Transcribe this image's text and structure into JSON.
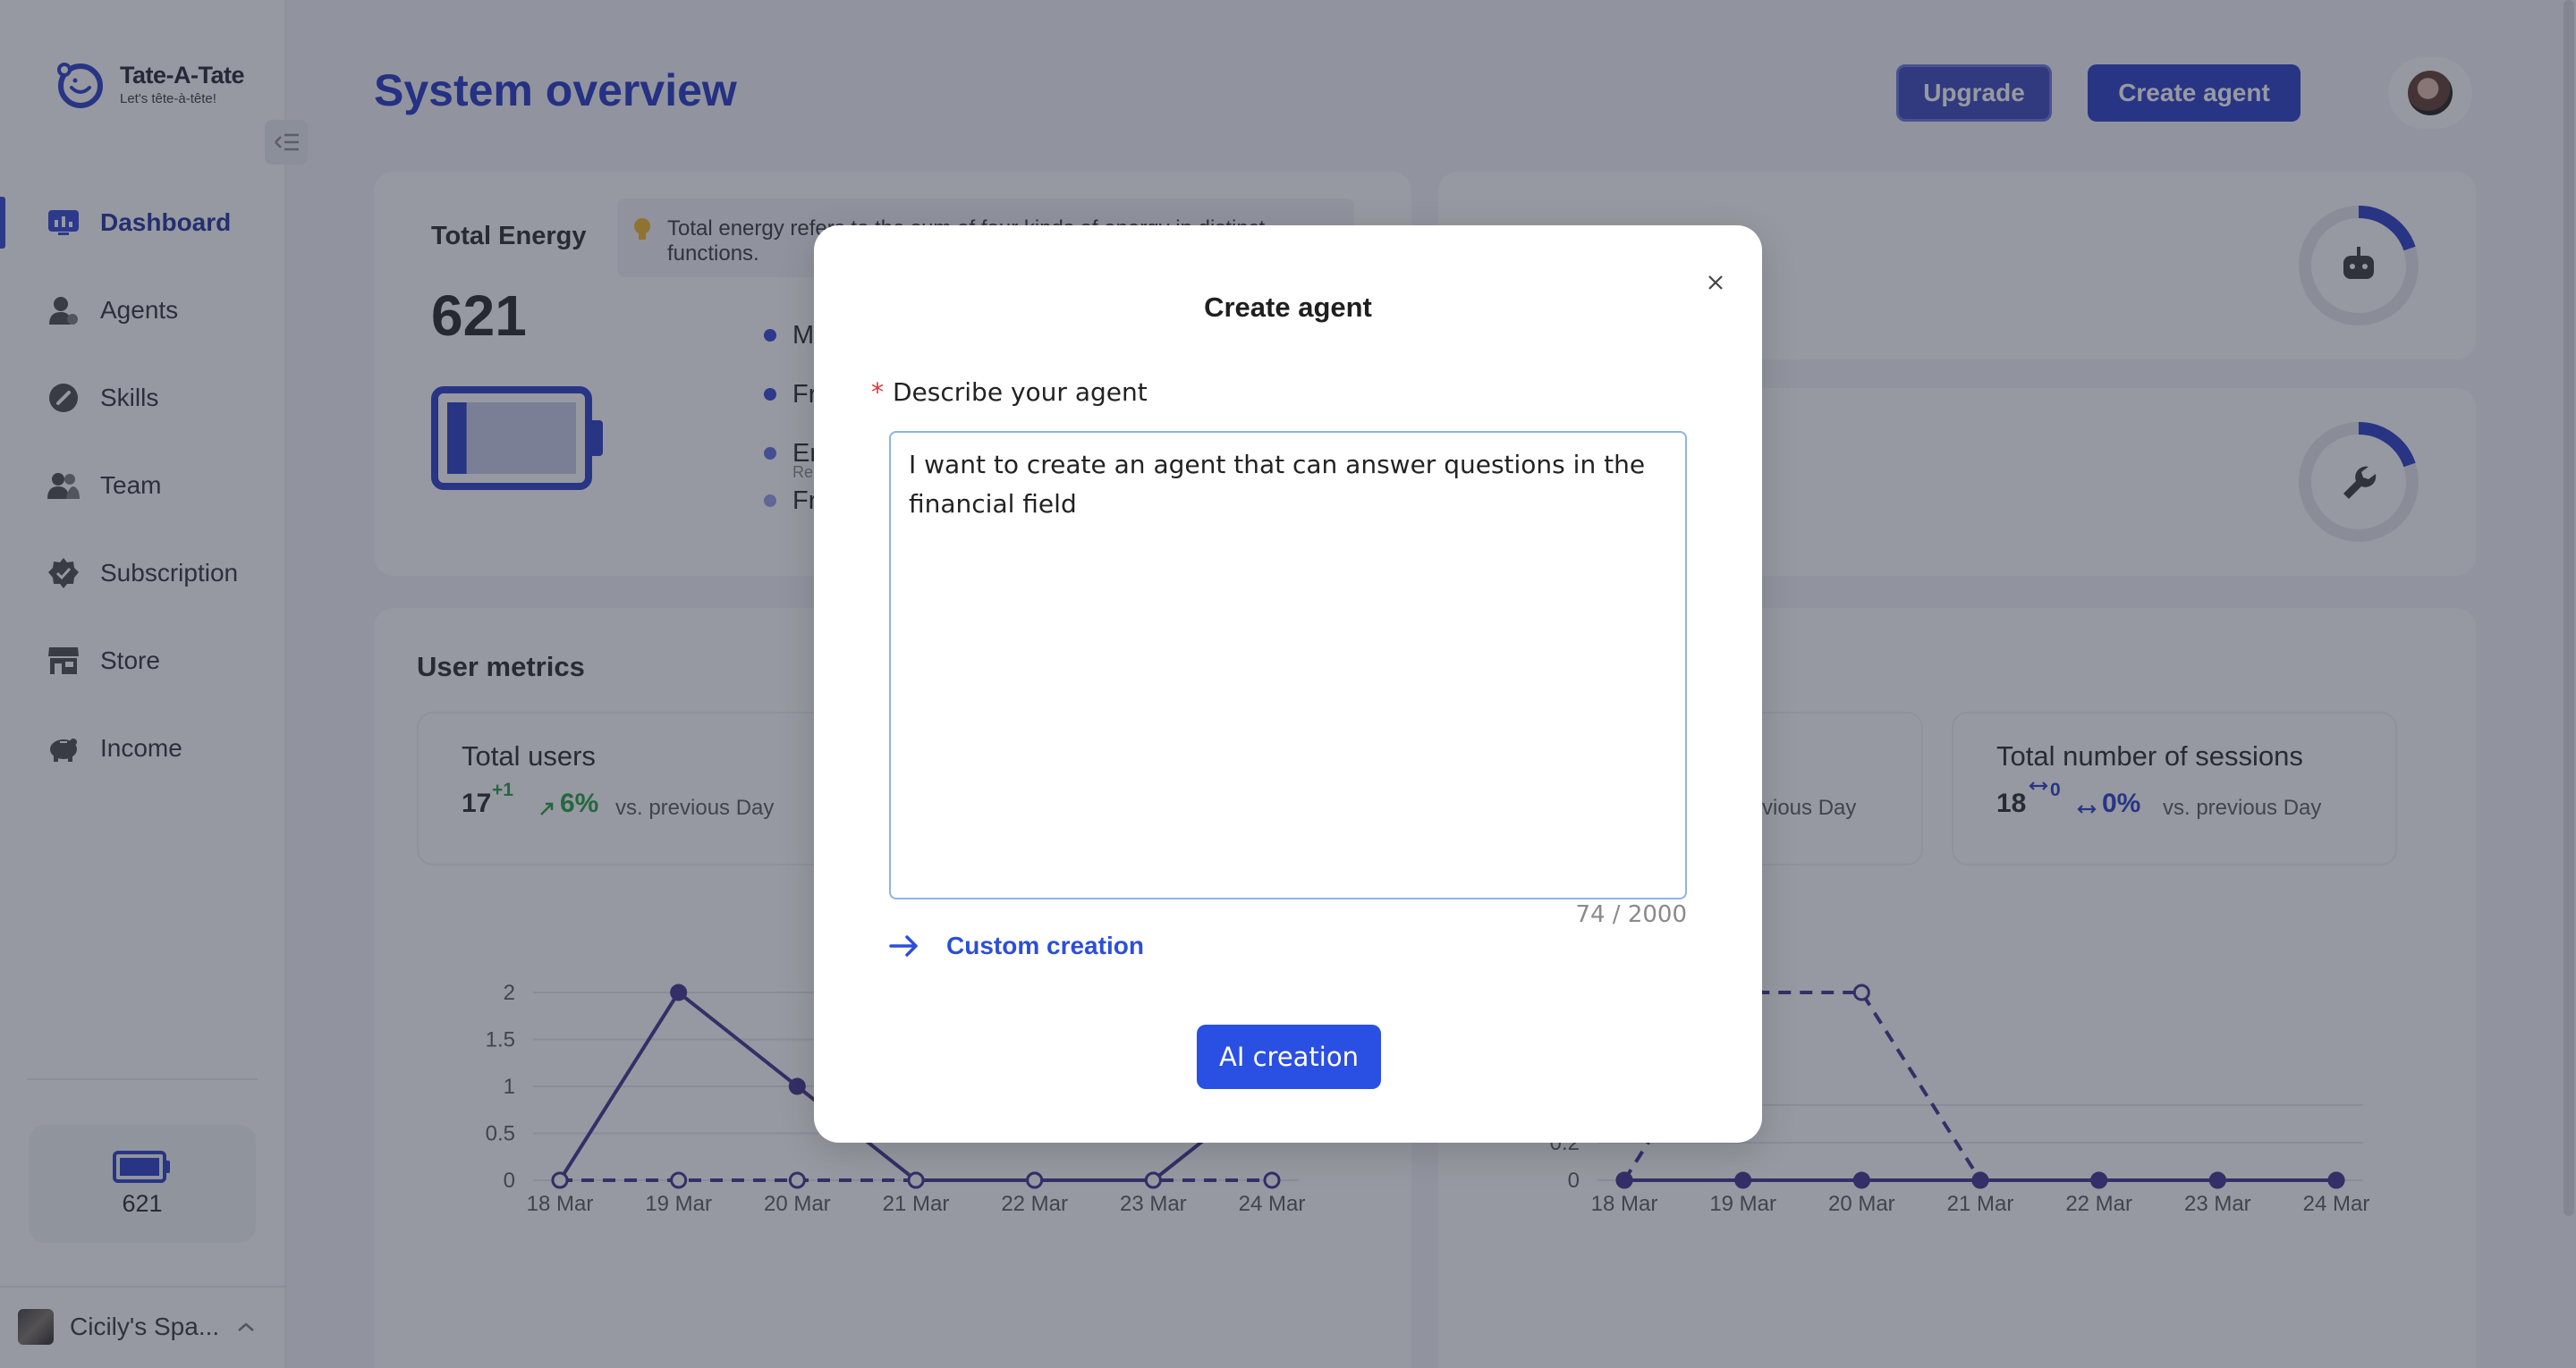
{
  "app": {
    "brand": "Tate-A-Tate",
    "tagline": "Let's tête-à-tête!",
    "page_title": "System overview"
  },
  "header": {
    "upgrade_label": "Upgrade",
    "create_agent_label": "Create agent"
  },
  "sidebar": {
    "items": [
      {
        "label": "Dashboard",
        "icon": "dashboard-icon",
        "active": true
      },
      {
        "label": "Agents",
        "icon": "agent-icon"
      },
      {
        "label": "Skills",
        "icon": "skill-icon"
      },
      {
        "label": "Team",
        "icon": "team-icon"
      },
      {
        "label": "Subscription",
        "icon": "subscription-icon"
      },
      {
        "label": "Store",
        "icon": "store-icon"
      },
      {
        "label": "Income",
        "icon": "piggy-bank-icon"
      }
    ],
    "energy_value": "621",
    "workspace_name": "Cicily's Spa..."
  },
  "energy": {
    "title": "Total Energy",
    "tip": "Total energy refers to the sum of four kinds of energy in distinct functions.",
    "value": "621",
    "battery_fill": 0.15,
    "legend": [
      {
        "label": "M"
      },
      {
        "label": "Fr"
      },
      {
        "label": "Er",
        "sub": "Re"
      },
      {
        "label": "Fr"
      }
    ]
  },
  "metrics": {
    "title": "User metrics",
    "total_users": {
      "label": "Total users",
      "value": "17",
      "delta": "+1",
      "pct": "6%",
      "vs": "vs. previous Day"
    },
    "hidden_card": {
      "vs": "vious Day"
    },
    "sessions": {
      "label": "Total number of sessions",
      "value": "18",
      "delta": "0",
      "pct": "0%",
      "vs": "vs. previous Day"
    }
  },
  "chart_data": [
    {
      "type": "line",
      "x": [
        "18 Mar",
        "19 Mar",
        "20 Mar",
        "21 Mar",
        "22 Mar",
        "23 Mar",
        "24 Mar"
      ],
      "ylim": [
        0,
        2
      ],
      "yticks": [
        "0",
        "0.5",
        "1",
        "1.5",
        "2"
      ],
      "series": [
        {
          "values": [
            0,
            2,
            1,
            0,
            0,
            0,
            1
          ]
        },
        {
          "values": [
            0,
            0,
            0,
            0,
            0,
            0,
            0
          ]
        }
      ]
    },
    {
      "type": "line",
      "x": [
        "18 Mar",
        "19 Mar",
        "20 Mar",
        "21 Mar",
        "22 Mar",
        "23 Mar",
        "24 Mar"
      ],
      "ylim": [
        0,
        1
      ],
      "yticks": [
        "0",
        "0.2",
        "0.4"
      ],
      "series": [
        {
          "values": [
            0,
            1,
            1,
            0,
            0,
            0,
            0
          ]
        },
        {
          "values": [
            0,
            0,
            0,
            0,
            0,
            0,
            0
          ]
        }
      ]
    }
  ],
  "modal": {
    "title": "Create agent",
    "field_label": "Describe your agent",
    "required_mark": "*",
    "textarea_value": "I want to create an agent that can answer questions in the financial field",
    "counter": "74 / 2000",
    "custom_creation_label": "Custom creation",
    "ai_creation_label": "AI creation"
  },
  "colors": {
    "primary": "#2336c6",
    "accent": "#2a4fe3",
    "positive": "#1e9b3a",
    "chart_line": "#3a2a8a"
  }
}
